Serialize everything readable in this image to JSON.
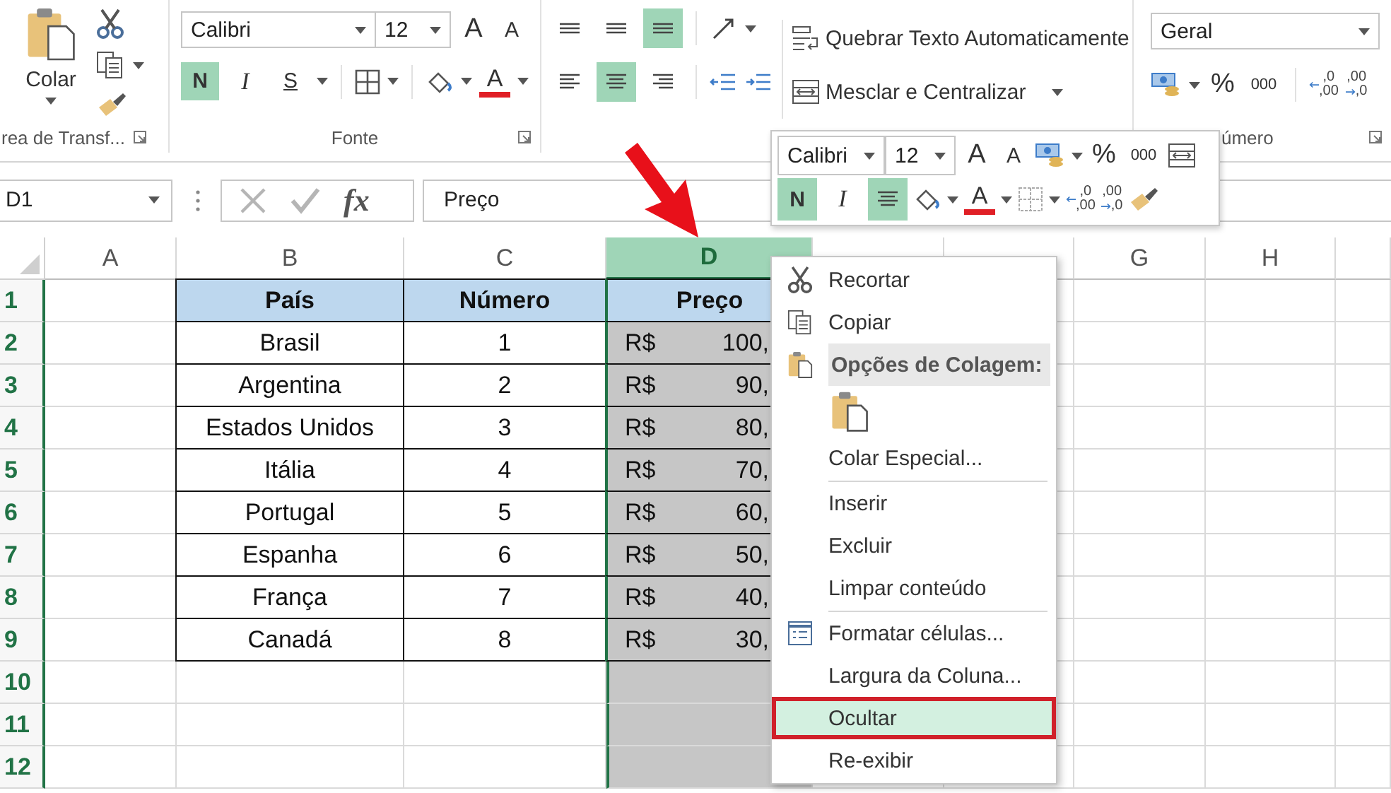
{
  "ribbon": {
    "clipboard": {
      "paste_label": "Colar",
      "group_label": "rea de Transf..."
    },
    "font": {
      "font_name": "Calibri",
      "font_size": "12",
      "grow_font": "A",
      "shrink_font": "A",
      "styles": [
        {
          "label": "N",
          "kind": "bold",
          "selected": true
        },
        {
          "label": "I",
          "kind": "italic",
          "selected": false
        },
        {
          "label": "S",
          "kind": "underline",
          "selected": false
        }
      ],
      "font_color": "A",
      "group_label": "Fonte"
    },
    "alignment": {
      "vertical": [
        {
          "selected": false
        },
        {
          "selected": false
        },
        {
          "selected": true
        }
      ],
      "horizontal": [
        {
          "selected": false
        },
        {
          "selected": true
        },
        {
          "selected": false
        }
      ],
      "wrap_text": "Quebrar Texto Automaticamente",
      "merge": "Mesclar e Centralizar"
    },
    "number": {
      "format": "Geral",
      "percent": "%",
      "thousands": "000",
      "decimal_increase": [
        ",0",
        ",00"
      ],
      "decimal_decrease": [
        ",00",
        ",0"
      ],
      "group_label": "úmero"
    }
  },
  "formula_bar": {
    "name_box": "D1",
    "fx": "fx",
    "formula": "Preço"
  },
  "sheet": {
    "columns": [
      {
        "label": "A",
        "selected": false
      },
      {
        "label": "B",
        "selected": false
      },
      {
        "label": "C",
        "selected": false
      },
      {
        "label": "D",
        "selected": true
      },
      {
        "selected": false
      },
      {
        "selected": false
      },
      {
        "label": "G",
        "selected": false
      },
      {
        "label": "H",
        "selected": false
      }
    ],
    "row_numbers": [
      "1",
      "2",
      "3",
      "4",
      "5",
      "6",
      "7",
      "8",
      "9",
      "10",
      "11",
      "12"
    ],
    "table_header": {
      "country": "País",
      "number": "Número",
      "price": "Preço"
    },
    "rows": [
      {
        "country": "Brasil",
        "number": "1",
        "currency": "R$",
        "price": "100,"
      },
      {
        "country": "Argentina",
        "number": "2",
        "currency": "R$",
        "price": "90,"
      },
      {
        "country": "Estados Unidos",
        "number": "3",
        "currency": "R$",
        "price": "80,"
      },
      {
        "country": "Itália",
        "number": "4",
        "currency": "R$",
        "price": "70,"
      },
      {
        "country": "Portugal",
        "number": "5",
        "currency": "R$",
        "price": "60,"
      },
      {
        "country": "Espanha",
        "number": "6",
        "currency": "R$",
        "price": "50,"
      },
      {
        "country": "França",
        "number": "7",
        "currency": "R$",
        "price": "40,"
      },
      {
        "country": "Canadá",
        "number": "8",
        "currency": "R$",
        "price": "30,"
      }
    ]
  },
  "mini_toolbar": {
    "font_name": "Calibri",
    "font_size": "12",
    "grow_font": "A",
    "shrink_font": "A",
    "percent": "%",
    "thousands": "000",
    "styles": [
      {
        "label": "N",
        "kind": "bold",
        "selected": true
      },
      {
        "label": "I",
        "kind": "italic",
        "selected": false
      }
    ],
    "center_selected": true,
    "font_color": "A",
    "decimal_increase": [
      ",0",
      ",00"
    ],
    "decimal_decrease": [
      ",00",
      ",0"
    ]
  },
  "context_menu": {
    "items": [
      {
        "kind": "command",
        "label": "Recortar",
        "separator": false,
        "selected": false
      },
      {
        "kind": "command",
        "label": "Copiar",
        "separator": false,
        "selected": false
      },
      {
        "kind": "header",
        "label": "Opções de Colagem:"
      },
      {
        "kind": "paste-options"
      },
      {
        "kind": "command",
        "label": "Colar Especial...",
        "separator": true,
        "selected": false
      },
      {
        "kind": "command",
        "label": "Inserir",
        "separator": false,
        "selected": false
      },
      {
        "kind": "command",
        "label": "Excluir",
        "separator": false,
        "selected": false
      },
      {
        "kind": "command",
        "label": "Limpar conteúdo",
        "separator": true,
        "selected": false
      },
      {
        "kind": "command",
        "label": "Formatar células...",
        "separator": false,
        "selected": false
      },
      {
        "kind": "command",
        "label": "Largura da Coluna...",
        "separator": false,
        "selected": false
      },
      {
        "kind": "command",
        "label": "Ocultar",
        "separator": false,
        "selected": true
      },
      {
        "kind": "command",
        "label": "Re-exibir",
        "separator": false,
        "selected": false
      }
    ]
  }
}
